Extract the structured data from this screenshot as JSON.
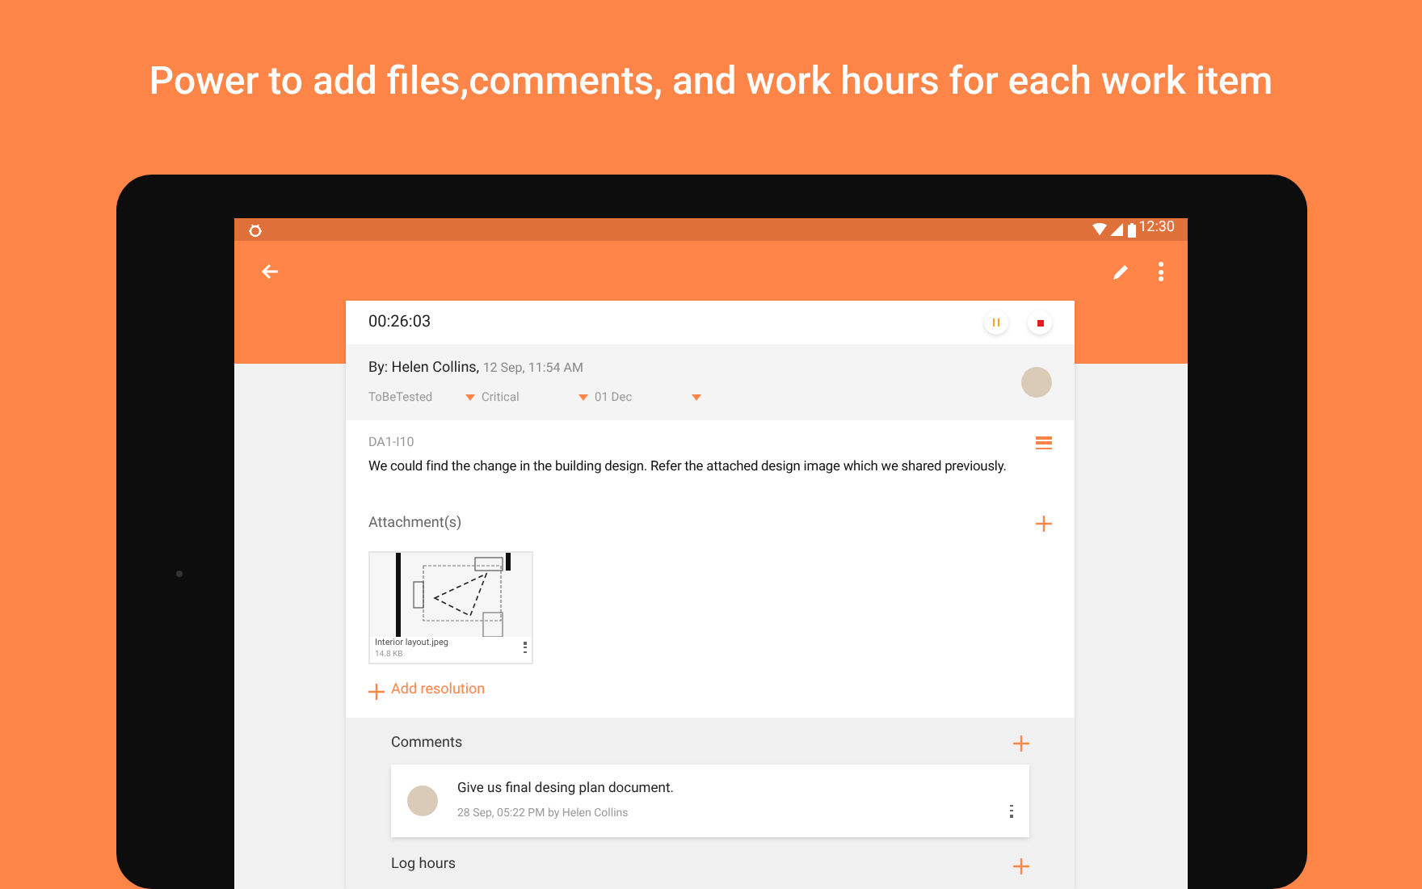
{
  "headline": "Power to add files,comments, and work hours for each work item",
  "status_bar": {
    "time": "12:30"
  },
  "timer": {
    "elapsed": "00:26:03"
  },
  "item": {
    "author": "By: Helen Collins,",
    "timestamp": "12 Sep, 11:54 AM",
    "dropdowns": [
      "ToBeTested",
      "Critical",
      "01 Dec"
    ],
    "id": "DA1-I10",
    "description": "We could find the change in the building design. Refer the attached design image which we shared previously."
  },
  "attachments": {
    "title": "Attachment(s)",
    "files": [
      {
        "name": "Interior layout.jpeg",
        "size": "14.8  KB"
      }
    ],
    "add_resolution": "Add resolution"
  },
  "comments": {
    "title": "Comments",
    "items": [
      {
        "text": "Give us final desing plan document.",
        "meta": "28 Sep, 05:22 PM by Helen Collins"
      }
    ]
  },
  "log_hours": {
    "title": "Log hours"
  }
}
